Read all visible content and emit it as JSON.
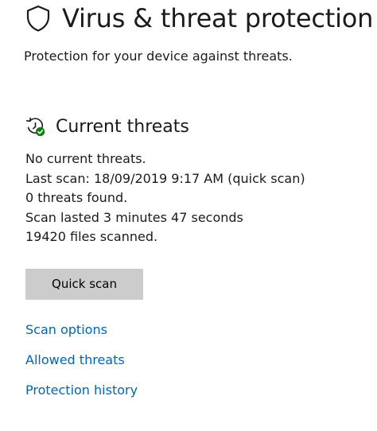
{
  "header": {
    "title": "Virus & threat protection",
    "subtitle": "Protection for your device against threats.",
    "icon": "shield-icon"
  },
  "current_threats": {
    "title": "Current threats",
    "icon": "threat-history-icon",
    "icon_accent_color": "#107c10",
    "status": "No current threats.",
    "last_scan": "Last scan: 18/09/2019 9:17 AM (quick scan)",
    "threats_found": "0 threats found.",
    "scan_duration": "Scan lasted 3 minutes 47 seconds",
    "files_scanned": "19420 files scanned."
  },
  "actions": {
    "quick_scan_label": "Quick scan"
  },
  "links": {
    "scan_options": "Scan options",
    "allowed_threats": "Allowed threats",
    "protection_history": "Protection history",
    "color": "#0067b8"
  }
}
